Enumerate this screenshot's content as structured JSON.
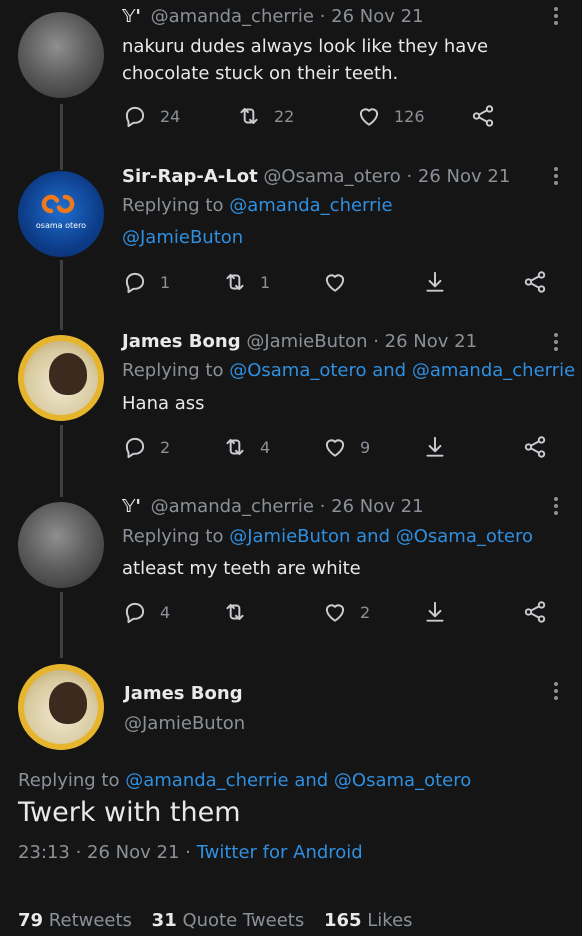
{
  "tweets": [
    {
      "icon": "twitter-logo-icon",
      "handle": "@amanda_cherrie",
      "date": "· 26 Nov 21",
      "lines": [
        "nakuru dudes always look like they have",
        "chocolate stuck on their teeth."
      ],
      "counts": {
        "replies": "24",
        "retweets": "22",
        "likes": "126"
      }
    },
    {
      "name": "Sir-Rap-A-Lot",
      "handle": "@Osama_otero",
      "date": "· 26 Nov 21",
      "replying_prefix": "Replying to",
      "replying_to": "@amanda_cherrie",
      "replying_to_2": "@JamieButon",
      "avatar_text": "osama otero",
      "counts": {
        "replies": "1",
        "retweets": "1",
        "likes": ""
      }
    },
    {
      "name": "James Bong",
      "handle": "@JamieButon",
      "date": "· 26 Nov 21",
      "replying_prefix": "Replying to",
      "replying_to": "@Osama_otero and @amanda_cherrie",
      "text": "Hana ass",
      "counts": {
        "replies": "2",
        "retweets": "4",
        "likes": "9"
      }
    },
    {
      "icon": "twitter-logo-icon",
      "handle": "@amanda_cherrie",
      "date": "· 26 Nov 21",
      "replying_prefix": "Replying to",
      "replying_to": "@JamieButon and @Osama_otero",
      "text": "atleast my teeth are white",
      "counts": {
        "replies": "4",
        "retweets": "",
        "likes": "2"
      }
    }
  ],
  "main_tweet": {
    "name": "James Bong",
    "handle": "@JamieButon",
    "replying_prefix": "Replying to",
    "replying_to": "@amanda_cherrie and @Osama_otero",
    "text": "Twerk with them",
    "timestamp": "23:13 · 26 Nov 21 ·",
    "source": "Twitter for Android",
    "stats": {
      "retweets_count": "79",
      "retweets_label": "Retweets",
      "quotes_count": "31",
      "quotes_label": "Quote Tweets",
      "likes_count": "165",
      "likes_label": "Likes"
    }
  },
  "colors": {
    "background": "#151515",
    "link": "#2f8fe0",
    "muted": "#8b9198",
    "text": "#e7e9ea"
  }
}
